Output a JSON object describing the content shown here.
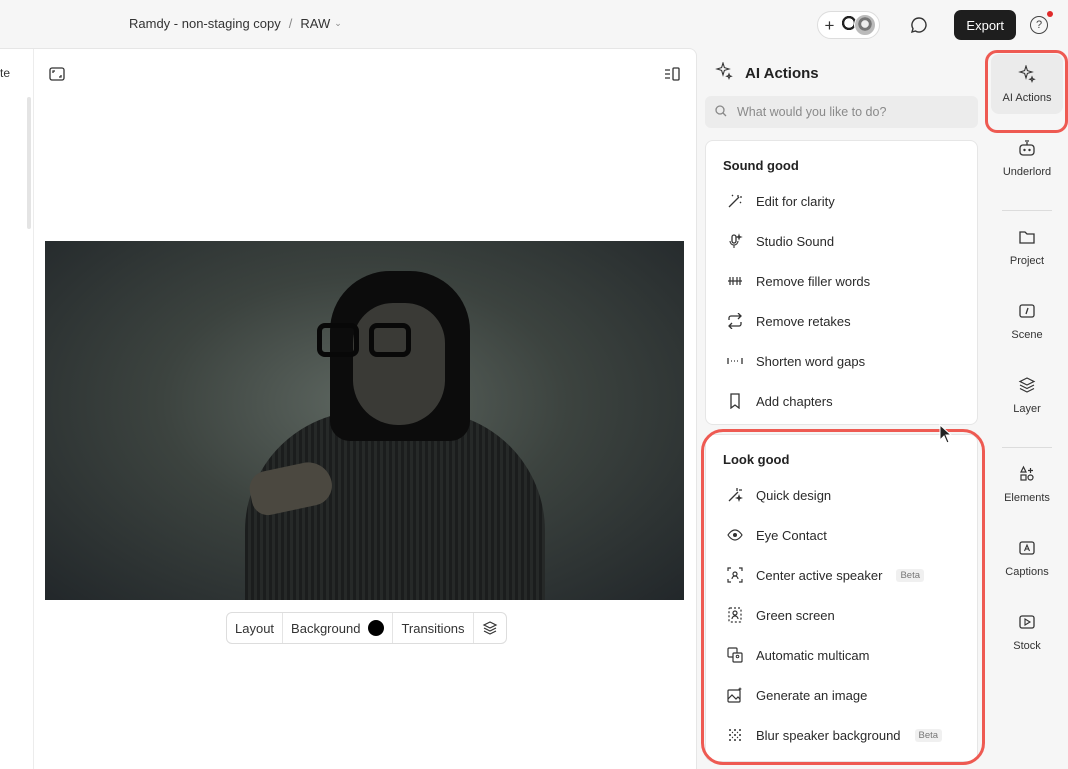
{
  "topbar": {
    "project_name": "Ramdy - non-staging copy",
    "separator": "/",
    "folder": "RAW",
    "export_label": "Export",
    "help_glyph": "?"
  },
  "canvas": {
    "left_strip_text": "te",
    "toolbar": {
      "layout_label": "Layout",
      "background_label": "Background",
      "background_color": "#000000",
      "transitions_label": "Transitions"
    }
  },
  "ai_actions": {
    "title": "AI Actions",
    "search_placeholder": "What would you like to do?",
    "sound_section": {
      "title": "Sound good",
      "items": [
        {
          "label": "Edit for clarity",
          "icon": "magic-wand-icon"
        },
        {
          "label": "Studio Sound",
          "icon": "microphone-sparkle-icon"
        },
        {
          "label": "Remove filler words",
          "icon": "filler-words-icon"
        },
        {
          "label": "Remove retakes",
          "icon": "repeat-icon"
        },
        {
          "label": "Shorten word gaps",
          "icon": "gap-icon"
        },
        {
          "label": "Add chapters",
          "icon": "bookmark-icon"
        }
      ]
    },
    "look_section": {
      "title": "Look good",
      "items": [
        {
          "label": "Quick design",
          "icon": "design-wand-icon"
        },
        {
          "label": "Eye Contact",
          "icon": "eye-icon"
        },
        {
          "label": "Center active speaker",
          "icon": "center-speaker-icon",
          "badge": "Beta"
        },
        {
          "label": "Green screen",
          "icon": "green-screen-icon"
        },
        {
          "label": "Automatic multicam",
          "icon": "multicam-icon"
        },
        {
          "label": "Generate an image",
          "icon": "generate-image-icon"
        },
        {
          "label": "Blur speaker background",
          "icon": "blur-icon",
          "badge": "Beta"
        }
      ]
    }
  },
  "sidebar": {
    "items": [
      {
        "label": "AI Actions",
        "icon": "sparkle-icon",
        "active": true
      },
      {
        "label": "Underlord",
        "icon": "robot-icon"
      },
      {
        "label": "Project",
        "icon": "folder-icon"
      },
      {
        "label": "Scene",
        "icon": "scene-icon"
      },
      {
        "label": "Layer",
        "icon": "layers-icon"
      },
      {
        "label": "Elements",
        "icon": "elements-icon"
      },
      {
        "label": "Captions",
        "icon": "captions-icon"
      },
      {
        "label": "Stock",
        "icon": "stock-icon"
      }
    ]
  },
  "colors": {
    "highlight": "#ee5a52",
    "export_bg": "#1e1e1e"
  }
}
